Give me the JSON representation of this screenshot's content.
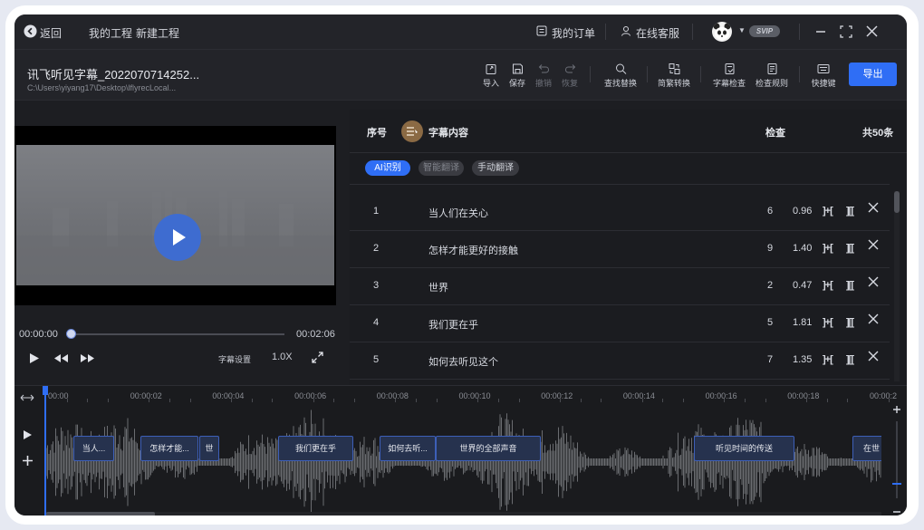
{
  "topbar": {
    "back_label": "返回",
    "my_projects": "我的工程",
    "new_project": "新建工程",
    "my_orders": "我的订单",
    "online_service": "在线客服",
    "vip_badge": "SVIP"
  },
  "project": {
    "title": "讯飞听见字幕_2022070714252...",
    "path": "C:\\Users\\yiyang17\\Desktop\\lflyrecLocal..."
  },
  "toolbar": {
    "import": "导入",
    "save": "保存",
    "undo": "撤销",
    "redo": "恢复",
    "find_replace": "查找替换",
    "trad_convert": "简繁转换",
    "subtitle_check": "字幕检查",
    "check_rules": "检查规则",
    "shortcuts": "快捷键",
    "export": "导出"
  },
  "player": {
    "current_time": "00:00:00",
    "total_time": "00:02:06",
    "subtitle_settings": "字幕设置",
    "speed": "1.0X",
    "progress": 0
  },
  "subtitles": {
    "col_index": "序号",
    "col_content": "字幕内容",
    "col_check": "检查",
    "total": "共50条",
    "tabs": [
      "AI识别",
      "智能翻译",
      "手动翻译"
    ],
    "split_icon": "]+[",
    "merge_icon": "][[",
    "rows": [
      {
        "index": "1",
        "text": "当人们在关心",
        "count": "6",
        "score": "0.96"
      },
      {
        "index": "2",
        "text": "怎样才能更好的接触",
        "count": "9",
        "score": "1.40"
      },
      {
        "index": "3",
        "text": "世界",
        "count": "2",
        "score": "0.47"
      },
      {
        "index": "4",
        "text": "我们更在乎",
        "count": "5",
        "score": "1.81"
      },
      {
        "index": "5",
        "text": "如何去听见这个",
        "count": "7",
        "score": "1.35"
      }
    ]
  },
  "timeline": {
    "ticks": [
      "00:00",
      "00:00:02",
      "00:00:04",
      "00:00:06",
      "00:00:08",
      "00:00:10",
      "00:00:12",
      "00:00:14",
      "00:00:16",
      "00:00:18",
      "00:00:2"
    ],
    "clips": [
      "当人...",
      "怎样才能...",
      "世",
      "我们更在乎",
      "如何去听...",
      "世界的全部声音",
      "听见时间的传送",
      "在世"
    ]
  },
  "colors": {
    "accent": "#2f6ef5",
    "background": "#1d1e22",
    "clip": "#26324e"
  }
}
